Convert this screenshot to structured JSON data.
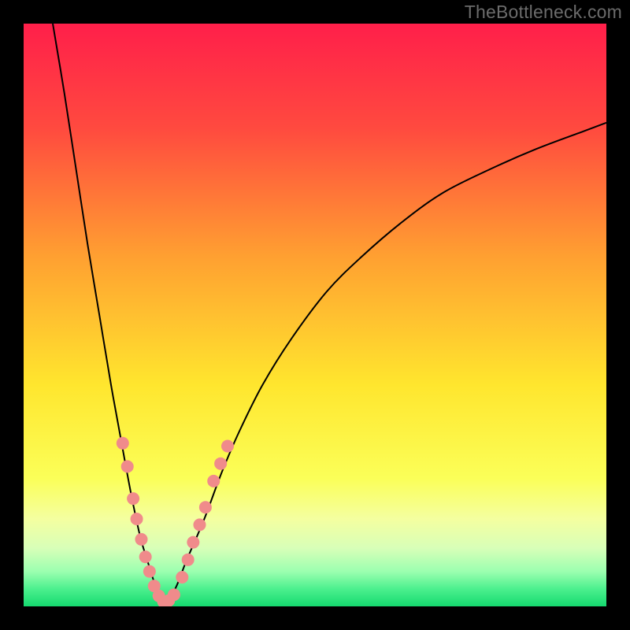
{
  "watermark": "TheBottleneck.com",
  "chart_data": {
    "type": "line",
    "title": "",
    "xlabel": "",
    "ylabel": "",
    "xlim": [
      0,
      100
    ],
    "ylim": [
      0,
      100
    ],
    "grid": false,
    "legend": false,
    "gradient_stops": [
      {
        "offset": 0.0,
        "color": "#ff1f4a"
      },
      {
        "offset": 0.18,
        "color": "#ff4a3f"
      },
      {
        "offset": 0.4,
        "color": "#ffa031"
      },
      {
        "offset": 0.62,
        "color": "#ffe62e"
      },
      {
        "offset": 0.78,
        "color": "#fbff58"
      },
      {
        "offset": 0.85,
        "color": "#f4ffa0"
      },
      {
        "offset": 0.9,
        "color": "#d8ffb8"
      },
      {
        "offset": 0.94,
        "color": "#9cffb0"
      },
      {
        "offset": 0.97,
        "color": "#4cf08e"
      },
      {
        "offset": 1.0,
        "color": "#15d96f"
      }
    ],
    "series": [
      {
        "name": "left-arm",
        "color": "#000000",
        "width": 2,
        "x": [
          5,
          7,
          9,
          11,
          13,
          15,
          17,
          18.5,
          20,
          21.5,
          22.8,
          24
        ],
        "y": [
          100,
          88,
          75,
          62,
          50,
          38,
          27,
          19,
          12,
          7,
          3,
          0.5
        ]
      },
      {
        "name": "right-arm",
        "color": "#000000",
        "width": 2,
        "x": [
          24,
          26,
          28,
          31,
          34,
          37,
          41,
          46,
          52,
          58,
          65,
          72,
          80,
          88,
          96,
          100
        ],
        "y": [
          0.5,
          3,
          8,
          15,
          23,
          30,
          38,
          46,
          54,
          60,
          66,
          71,
          75,
          78.5,
          81.5,
          83
        ]
      }
    ],
    "scatter": {
      "name": "data-markers",
      "color": "#f08b8b",
      "radius": 8,
      "points": [
        {
          "x": 17.0,
          "y": 28.0
        },
        {
          "x": 17.8,
          "y": 24.0
        },
        {
          "x": 18.8,
          "y": 18.5
        },
        {
          "x": 19.4,
          "y": 15.0
        },
        {
          "x": 20.2,
          "y": 11.5
        },
        {
          "x": 20.9,
          "y": 8.5
        },
        {
          "x": 21.6,
          "y": 6.0
        },
        {
          "x": 22.4,
          "y": 3.5
        },
        {
          "x": 23.2,
          "y": 1.8
        },
        {
          "x": 24.0,
          "y": 0.8
        },
        {
          "x": 24.9,
          "y": 1.0
        },
        {
          "x": 25.8,
          "y": 2.0
        },
        {
          "x": 27.2,
          "y": 5.0
        },
        {
          "x": 28.2,
          "y": 8.0
        },
        {
          "x": 29.1,
          "y": 11.0
        },
        {
          "x": 30.2,
          "y": 14.0
        },
        {
          "x": 31.2,
          "y": 17.0
        },
        {
          "x": 32.6,
          "y": 21.5
        },
        {
          "x": 33.8,
          "y": 24.5
        },
        {
          "x": 35.0,
          "y": 27.5
        }
      ]
    }
  }
}
